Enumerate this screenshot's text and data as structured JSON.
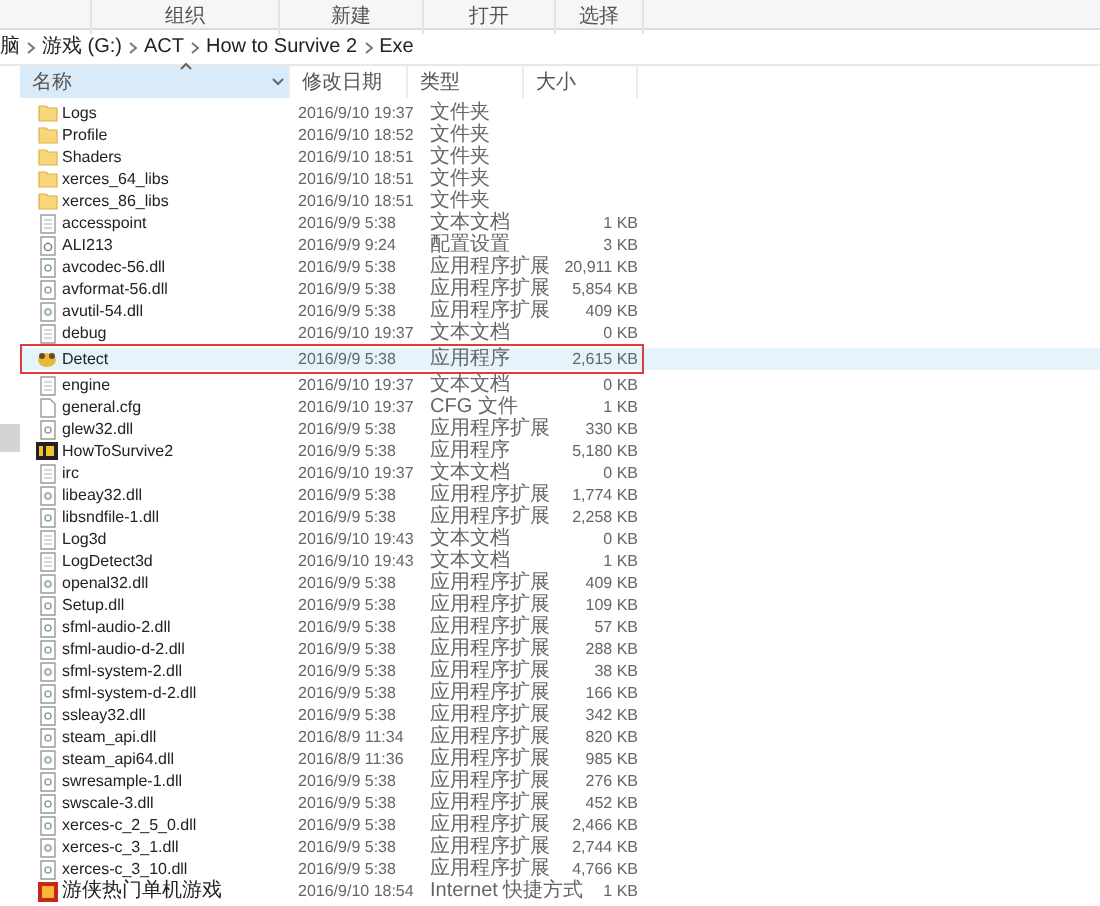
{
  "ribbon": {
    "groups": [
      "组织",
      "新建",
      "打开",
      "选择"
    ]
  },
  "breadcrumb": [
    "脑",
    "游戏 (G:)",
    "ACT",
    "How to Survive 2",
    "Exe"
  ],
  "table": {
    "columns": [
      {
        "label": "名称",
        "sorted": true
      },
      {
        "label": "修改日期",
        "sorted": false
      },
      {
        "label": "类型",
        "sorted": false
      },
      {
        "label": "大小",
        "sorted": false
      }
    ],
    "rows": [
      {
        "kind": "folder",
        "name": "Logs",
        "date": "2016/9/10 19:37",
        "type": "文件夹",
        "size": "",
        "highlighted": false
      },
      {
        "kind": "folder",
        "name": "Profile",
        "date": "2016/9/10 18:52",
        "type": "文件夹",
        "size": "",
        "highlighted": false
      },
      {
        "kind": "folder",
        "name": "Shaders",
        "date": "2016/9/10 18:51",
        "type": "文件夹",
        "size": "",
        "highlighted": false
      },
      {
        "kind": "folder",
        "name": "xerces_64_libs",
        "date": "2016/9/10 18:51",
        "type": "文件夹",
        "size": "",
        "highlighted": false
      },
      {
        "kind": "folder",
        "name": "xerces_86_libs",
        "date": "2016/9/10 18:51",
        "type": "文件夹",
        "size": "",
        "highlighted": false
      },
      {
        "kind": "text",
        "name": "accesspoint",
        "date": "2016/9/9 5:38",
        "type": "文本文档",
        "size": "1 KB",
        "highlighted": false
      },
      {
        "kind": "settings",
        "name": "ALI213",
        "date": "2016/9/9 9:24",
        "type": "配置设置",
        "size": "3 KB",
        "highlighted": false
      },
      {
        "kind": "dll",
        "name": "avcodec-56.dll",
        "date": "2016/9/9 5:38",
        "type": "应用程序扩展",
        "size": "20,911 KB",
        "highlighted": false
      },
      {
        "kind": "dll",
        "name": "avformat-56.dll",
        "date": "2016/9/9 5:38",
        "type": "应用程序扩展",
        "size": "5,854 KB",
        "highlighted": false
      },
      {
        "kind": "dll",
        "name": "avutil-54.dll",
        "date": "2016/9/9 5:38",
        "type": "应用程序扩展",
        "size": "409 KB",
        "highlighted": false
      },
      {
        "kind": "text",
        "name": "debug",
        "date": "2016/9/10 19:37",
        "type": "文本文档",
        "size": "0 KB",
        "highlighted": false
      },
      {
        "kind": "exe",
        "name": "Detect",
        "date": "2016/9/9 5:38",
        "type": "应用程序",
        "size": "2,615 KB",
        "highlighted": true
      },
      {
        "kind": "text",
        "name": "engine",
        "date": "2016/9/10 19:37",
        "type": "文本文档",
        "size": "0 KB",
        "highlighted": false
      },
      {
        "kind": "file",
        "name": "general.cfg",
        "date": "2016/9/10 19:37",
        "type": "CFG 文件",
        "size": "1 KB",
        "highlighted": false
      },
      {
        "kind": "dll",
        "name": "glew32.dll",
        "date": "2016/9/9 5:38",
        "type": "应用程序扩展",
        "size": "330 KB",
        "highlighted": false
      },
      {
        "kind": "app",
        "name": "HowToSurvive2",
        "date": "2016/9/9 5:38",
        "type": "应用程序",
        "size": "5,180 KB",
        "highlighted": false
      },
      {
        "kind": "text",
        "name": "irc",
        "date": "2016/9/10 19:37",
        "type": "文本文档",
        "size": "0 KB",
        "highlighted": false
      },
      {
        "kind": "dll",
        "name": "libeay32.dll",
        "date": "2016/9/9 5:38",
        "type": "应用程序扩展",
        "size": "1,774 KB",
        "highlighted": false
      },
      {
        "kind": "dll",
        "name": "libsndfile-1.dll",
        "date": "2016/9/9 5:38",
        "type": "应用程序扩展",
        "size": "2,258 KB",
        "highlighted": false
      },
      {
        "kind": "text",
        "name": "Log3d",
        "date": "2016/9/10 19:43",
        "type": "文本文档",
        "size": "0 KB",
        "highlighted": false
      },
      {
        "kind": "text",
        "name": "LogDetect3d",
        "date": "2016/9/10 19:43",
        "type": "文本文档",
        "size": "1 KB",
        "highlighted": false
      },
      {
        "kind": "dll",
        "name": "openal32.dll",
        "date": "2016/9/9 5:38",
        "type": "应用程序扩展",
        "size": "409 KB",
        "highlighted": false
      },
      {
        "kind": "dll",
        "name": "Setup.dll",
        "date": "2016/9/9 5:38",
        "type": "应用程序扩展",
        "size": "109 KB",
        "highlighted": false
      },
      {
        "kind": "dll",
        "name": "sfml-audio-2.dll",
        "date": "2016/9/9 5:38",
        "type": "应用程序扩展",
        "size": "57 KB",
        "highlighted": false
      },
      {
        "kind": "dll",
        "name": "sfml-audio-d-2.dll",
        "date": "2016/9/9 5:38",
        "type": "应用程序扩展",
        "size": "288 KB",
        "highlighted": false
      },
      {
        "kind": "dll",
        "name": "sfml-system-2.dll",
        "date": "2016/9/9 5:38",
        "type": "应用程序扩展",
        "size": "38 KB",
        "highlighted": false
      },
      {
        "kind": "dll",
        "name": "sfml-system-d-2.dll",
        "date": "2016/9/9 5:38",
        "type": "应用程序扩展",
        "size": "166 KB",
        "highlighted": false
      },
      {
        "kind": "dll",
        "name": "ssleay32.dll",
        "date": "2016/9/9 5:38",
        "type": "应用程序扩展",
        "size": "342 KB",
        "highlighted": false
      },
      {
        "kind": "dll",
        "name": "steam_api.dll",
        "date": "2016/8/9 11:34",
        "type": "应用程序扩展",
        "size": "820 KB",
        "highlighted": false
      },
      {
        "kind": "dll",
        "name": "steam_api64.dll",
        "date": "2016/8/9 11:36",
        "type": "应用程序扩展",
        "size": "985 KB",
        "highlighted": false
      },
      {
        "kind": "dll",
        "name": "swresample-1.dll",
        "date": "2016/9/9 5:38",
        "type": "应用程序扩展",
        "size": "276 KB",
        "highlighted": false
      },
      {
        "kind": "dll",
        "name": "swscale-3.dll",
        "date": "2016/9/9 5:38",
        "type": "应用程序扩展",
        "size": "452 KB",
        "highlighted": false
      },
      {
        "kind": "dll",
        "name": "xerces-c_2_5_0.dll",
        "date": "2016/9/9 5:38",
        "type": "应用程序扩展",
        "size": "2,466 KB",
        "highlighted": false
      },
      {
        "kind": "dll",
        "name": "xerces-c_3_1.dll",
        "date": "2016/9/9 5:38",
        "type": "应用程序扩展",
        "size": "2,744 KB",
        "highlighted": false
      },
      {
        "kind": "dll",
        "name": "xerces-c_3_10.dll",
        "date": "2016/9/9 5:38",
        "type": "应用程序扩展",
        "size": "4,766 KB",
        "highlighted": false
      },
      {
        "kind": "shortcut",
        "name": "游侠热门单机游戏",
        "date": "2016/9/10 18:54",
        "type": "Internet 快捷方式",
        "size": "1 KB",
        "highlighted": false
      }
    ]
  }
}
